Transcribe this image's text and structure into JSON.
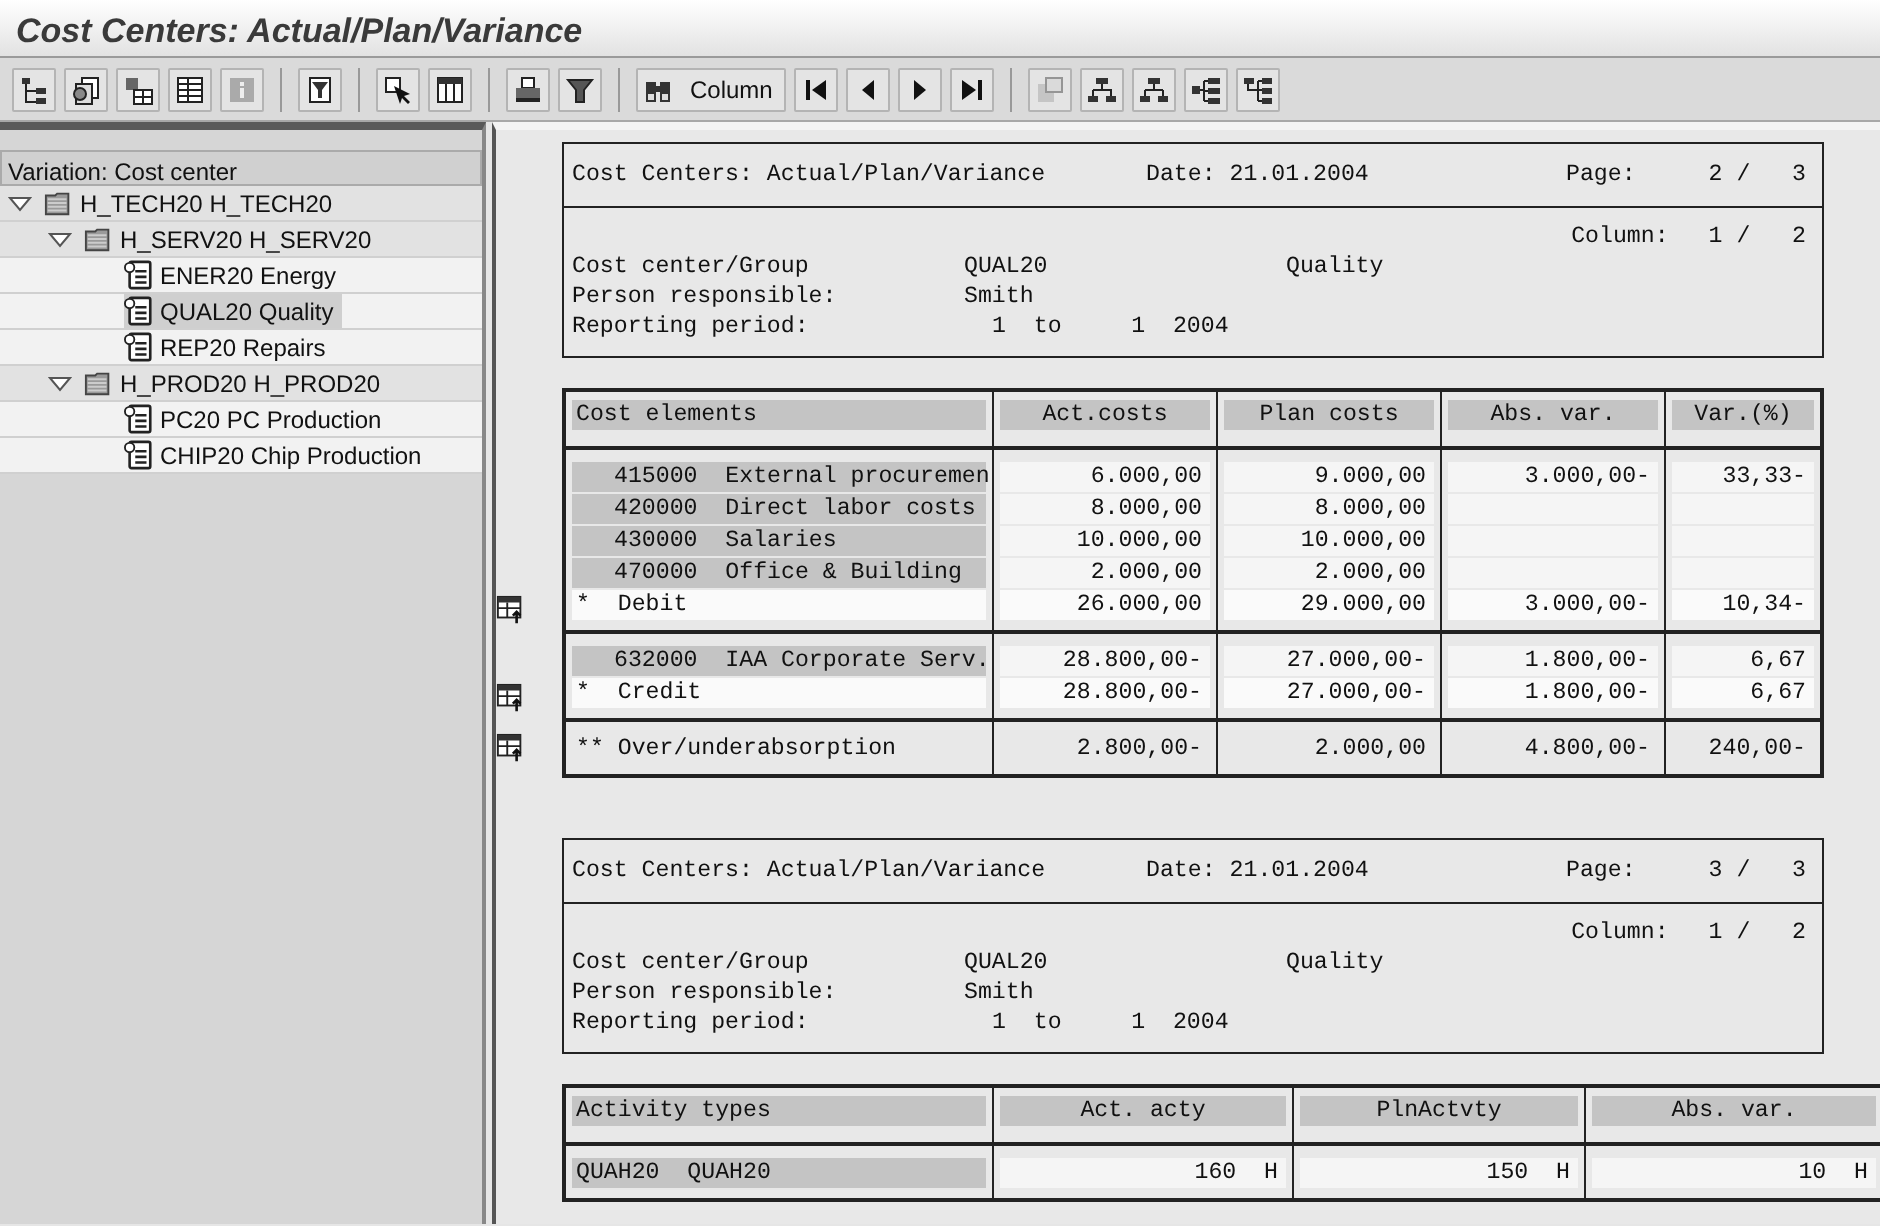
{
  "window": {
    "title": "Cost Centers: Actual/Plan/Variance"
  },
  "toolbar": {
    "groups": [
      [
        {
          "disabled": false
        },
        {
          "disabled": false
        },
        {
          "disabled": false
        },
        {
          "disabled": false
        },
        {
          "disabled": true
        }
      ],
      [
        {
          "disabled": false
        }
      ],
      [
        {
          "disabled": false
        },
        {
          "disabled": false
        }
      ],
      [
        {
          "disabled": false
        },
        {
          "disabled": false
        }
      ],
      [
        {
          "label": "Column",
          "disabled": false
        },
        {
          "disabled": false
        },
        {
          "disabled": false
        },
        {
          "disabled": false
        },
        {
          "disabled": false
        }
      ],
      [
        {
          "disabled": true
        },
        {
          "disabled": false
        },
        {
          "disabled": false
        },
        {
          "disabled": false
        },
        {
          "disabled": false
        }
      ]
    ]
  },
  "navigation": {
    "header": "Variation: Cost center",
    "tree": [
      {
        "kind": "folder",
        "label": "H_TECH20 H_TECH20",
        "expanded": true,
        "selected": false,
        "children": [
          {
            "kind": "folder",
            "label": "H_SERV20 H_SERV20",
            "expanded": true,
            "selected": false,
            "children": [
              {
                "kind": "cost_center",
                "label": "ENER20 Energy",
                "selected": false
              },
              {
                "kind": "cost_center",
                "label": "QUAL20 Quality",
                "selected": true
              },
              {
                "kind": "cost_center",
                "label": "REP20 Repairs",
                "selected": false
              }
            ]
          },
          {
            "kind": "folder",
            "label": "H_PROD20 H_PROD20",
            "expanded": true,
            "selected": false,
            "children": [
              {
                "kind": "cost_center",
                "label": "PC20 PC Production",
                "selected": false
              },
              {
                "kind": "cost_center",
                "label": "CHIP20 Chip Production",
                "selected": false
              }
            ]
          }
        ]
      }
    ]
  },
  "report": {
    "pages": [
      {
        "header": {
          "title": "Cost Centers: Actual/Plan/Variance",
          "date_label": "Date:",
          "date": "21.01.2004",
          "page_label": "Page:",
          "page": "2 /   3",
          "column_label": "Column:",
          "column": "1 /   2",
          "fields": [
            {
              "label": "Cost center/Group",
              "value": "QUAL20",
              "description": "Quality"
            },
            {
              "label": "Person responsible:",
              "value": "Smith"
            },
            {
              "label": "Reporting period:",
              "value": "1  to     1  2004"
            }
          ]
        },
        "table": {
          "columns": [
            "Cost elements",
            "Act.costs",
            "Plan costs",
            "Abs. var.",
            "Var.(%)"
          ],
          "sections": [
            [
              {
                "kind": "item",
                "cells": [
                  "415000  External procuremen",
                  "6.000,00",
                  "9.000,00",
                  "3.000,00-",
                  "33,33-"
                ]
              },
              {
                "kind": "item",
                "cells": [
                  "420000  Direct labor costs",
                  "8.000,00",
                  "8.000,00",
                  null,
                  null
                ]
              },
              {
                "kind": "item",
                "cells": [
                  "430000  Salaries",
                  "10.000,00",
                  "10.000,00",
                  null,
                  null
                ]
              },
              {
                "kind": "item",
                "cells": [
                  "470000  Office & Building",
                  "2.000,00",
                  "2.000,00",
                  null,
                  null
                ]
              },
              {
                "kind": "subtotal",
                "cells": [
                  "*  Debit",
                  "26.000,00",
                  "29.000,00",
                  "3.000,00-",
                  "10,34-"
                ]
              }
            ],
            [
              {
                "kind": "item",
                "cells": [
                  "632000  IAA Corporate Serv.",
                  "28.800,00-",
                  "27.000,00-",
                  "1.800,00-",
                  "6,67"
                ]
              },
              {
                "kind": "subtotal",
                "cells": [
                  "*  Credit",
                  "28.800,00-",
                  "27.000,00-",
                  "1.800,00-",
                  "6,67"
                ]
              }
            ],
            [
              {
                "kind": "grand_total",
                "cells": [
                  "** Over/underabsorption",
                  "2.800,00-",
                  "2.000,00",
                  "4.800,00-",
                  "240,00-"
                ]
              }
            ]
          ]
        }
      },
      {
        "header": {
          "title": "Cost Centers: Actual/Plan/Variance",
          "date_label": "Date:",
          "date": "21.01.2004",
          "page_label": "Page:",
          "page": "3 /   3",
          "column_label": "Column:",
          "column": "1 /   2",
          "fields": [
            {
              "label": "Cost center/Group",
              "value": "QUAL20",
              "description": "Quality"
            },
            {
              "label": "Person responsible:",
              "value": "Smith"
            },
            {
              "label": "Reporting period:",
              "value": "1  to     1  2004"
            }
          ]
        },
        "table": {
          "columns": [
            "Activity types",
            "Act. acty",
            "PlnActvty",
            "Abs. var."
          ],
          "sections": [
            [
              {
                "kind": "activity",
                "cells": [
                  "QUAH20  QUAH20",
                  "160  H",
                  "150  H",
                  "10  H"
                ]
              }
            ]
          ]
        }
      }
    ]
  }
}
